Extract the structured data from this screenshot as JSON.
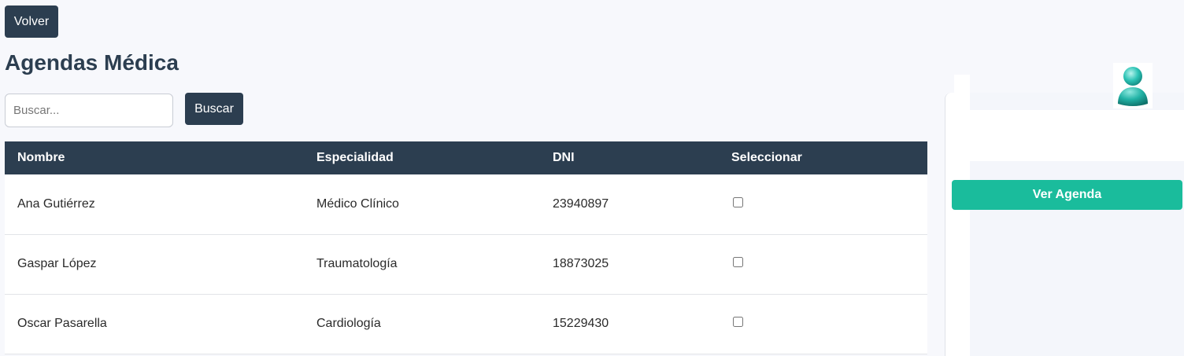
{
  "header": {
    "back_label": "Volver",
    "title": "Agendas Médica"
  },
  "search": {
    "placeholder": "Buscar...",
    "value": "",
    "button_label": "Buscar"
  },
  "table": {
    "columns": [
      "Nombre",
      "Especialidad",
      "DNI",
      "Seleccionar"
    ],
    "rows": [
      {
        "nombre": "Ana Gutiérrez",
        "especialidad": "Médico Clínico",
        "dni": "23940897",
        "selected": false
      },
      {
        "nombre": "Gaspar López",
        "especialidad": "Traumatología",
        "dni": "18873025",
        "selected": false
      },
      {
        "nombre": "Oscar Pasarella",
        "especialidad": "Cardiología",
        "dni": "15229430",
        "selected": false
      }
    ]
  },
  "sidebar": {
    "avatar_icon": "user-avatar-icon",
    "view_agenda_label": "Ver Agenda"
  },
  "colors": {
    "primary_dark": "#2c3e50",
    "accent": "#1abc9c",
    "background": "#f7f8fc"
  }
}
